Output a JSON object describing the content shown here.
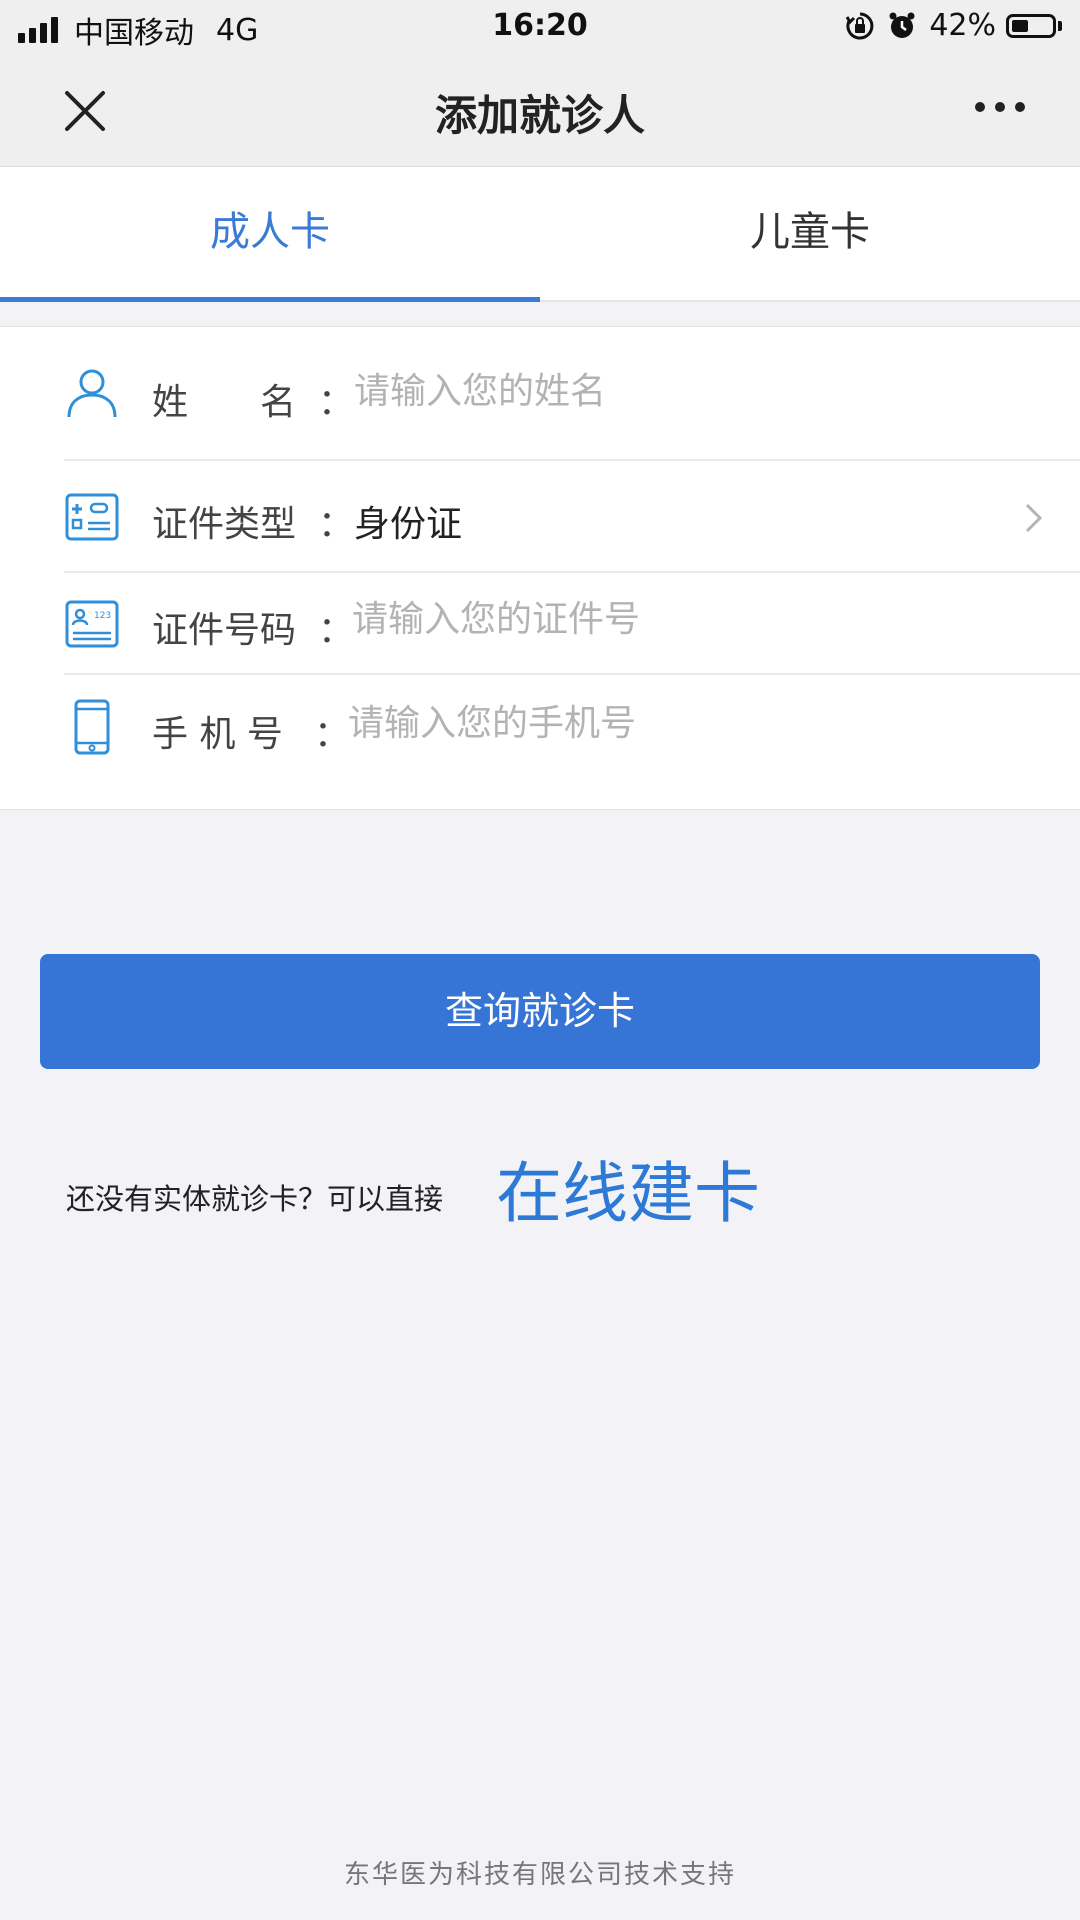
{
  "status_bar": {
    "carrier": "中国移动",
    "network": "4G",
    "time": "16:20",
    "battery_text": "42%",
    "battery_level": 0.42
  },
  "nav": {
    "title": "添加就诊人",
    "close_icon": "close-icon",
    "more_icon": "more-icon"
  },
  "tabs": [
    {
      "label": "成人卡",
      "active": true
    },
    {
      "label": "儿童卡",
      "active": false
    }
  ],
  "form": {
    "name": {
      "label": "姓　　名",
      "colon": "：",
      "placeholder": "请输入您的姓名",
      "icon": "person-icon"
    },
    "id_type": {
      "label": "证件类型",
      "colon": "：",
      "value": "身份证",
      "icon": "id-type-icon"
    },
    "id_number": {
      "label": "证件号码",
      "colon": "：",
      "placeholder": "请输入您的证件号",
      "icon": "id-card-icon"
    },
    "phone": {
      "label": "手 机 号",
      "colon": "：",
      "placeholder": "请输入您的手机号",
      "icon": "phone-icon"
    }
  },
  "query_button": {
    "label": "查询就诊卡"
  },
  "online": {
    "prompt": "还没有实体就诊卡？可以直接",
    "link": "在线建卡"
  },
  "footer": {
    "text": "东华医为科技有限公司技术支持"
  },
  "colors": {
    "accent": "#3a7bd5",
    "button": "#3675d5",
    "link": "#2c7ad6",
    "icon": "#2f8fd8"
  }
}
